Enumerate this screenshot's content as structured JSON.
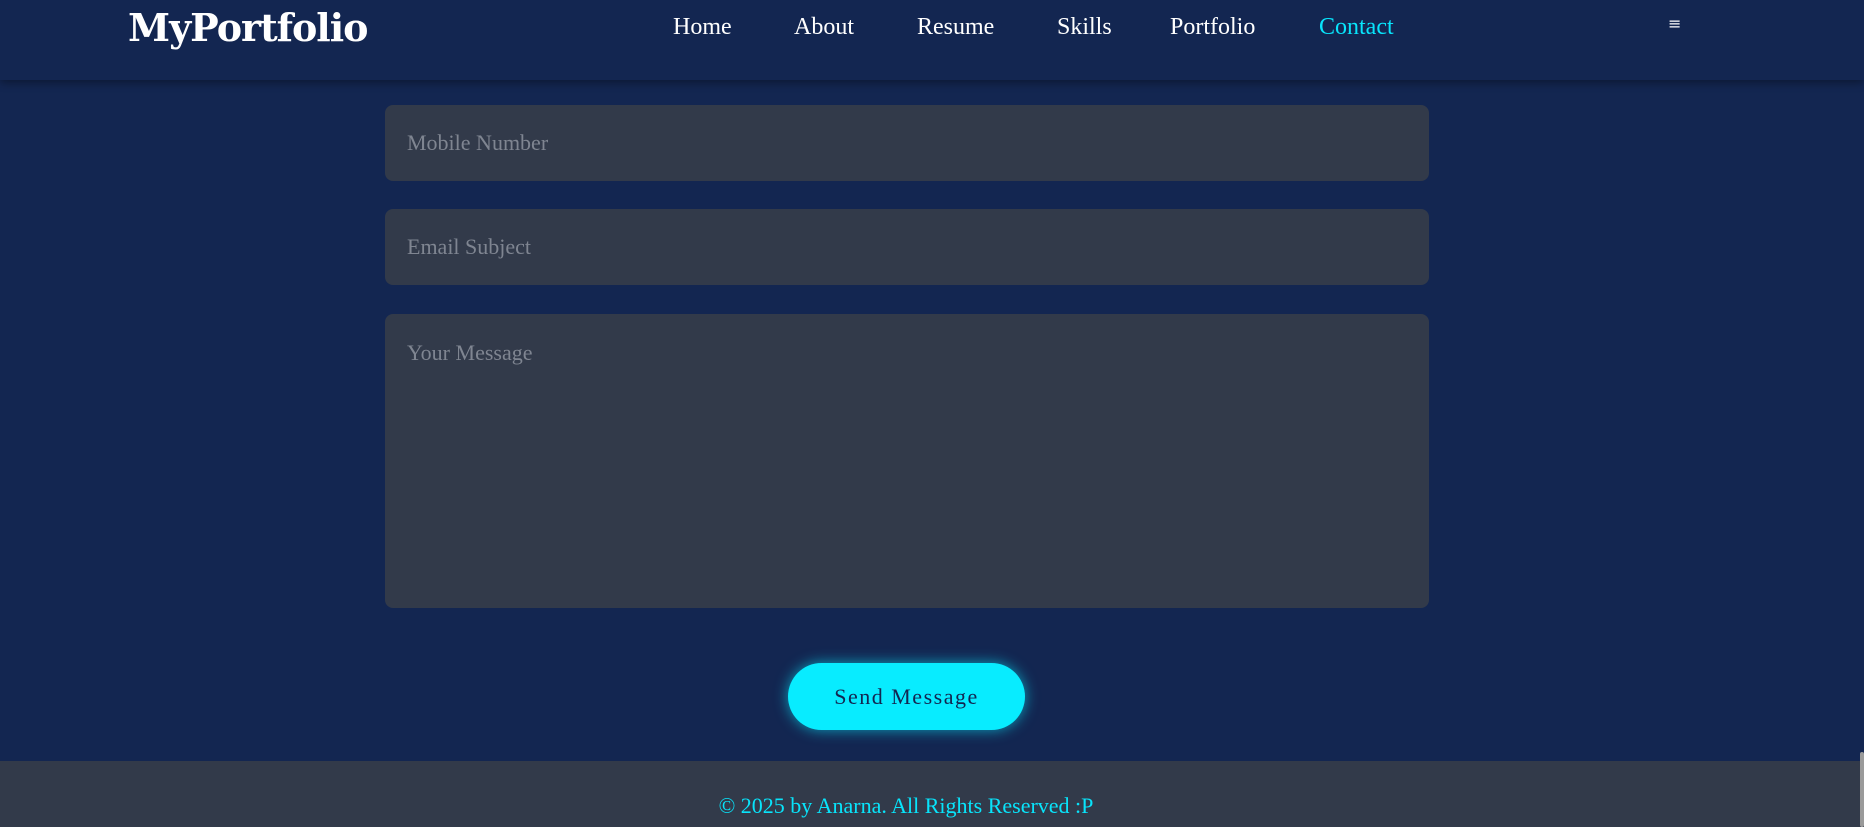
{
  "header": {
    "logo": "MyPortfolio",
    "nav": [
      {
        "label": "Home"
      },
      {
        "label": "About"
      },
      {
        "label": "Resume"
      },
      {
        "label": "Skills"
      },
      {
        "label": "Portfolio"
      },
      {
        "label": "Contact",
        "active": true
      }
    ],
    "menu_icon": "≡"
  },
  "form": {
    "mobile_placeholder": "Mobile Number",
    "subject_placeholder": "Email Subject",
    "message_placeholder": "Your Message",
    "send_label": "Send Message"
  },
  "footer": {
    "text": "© 2025 by Anarna. All Rights Reserved :P"
  },
  "colors": {
    "background": "#132651",
    "input_background": "#323a4a",
    "accent": "#08e4fb",
    "text": "#ffffff",
    "placeholder": "#7f8591"
  }
}
